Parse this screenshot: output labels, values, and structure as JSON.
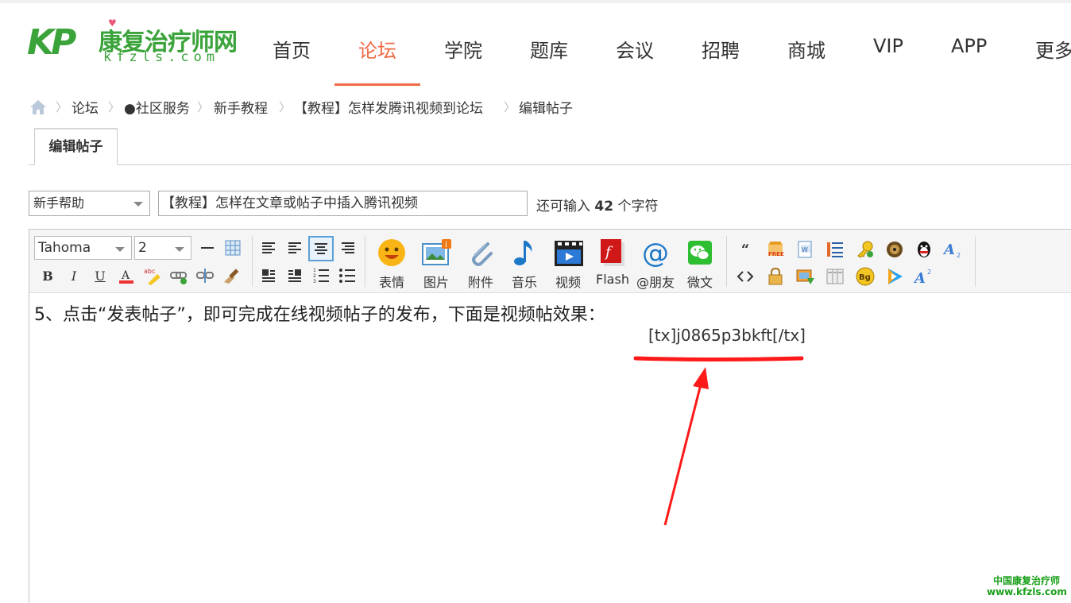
{
  "site": {
    "logo_mark": "KP",
    "logo_cn": "康复治疗师网",
    "logo_en": "kfzls.com"
  },
  "nav": {
    "items": [
      "首页",
      "论坛",
      "学院",
      "题库",
      "会议",
      "招聘",
      "商城",
      "VIP",
      "APP",
      "更多"
    ],
    "active_index": 1
  },
  "breadcrumb": {
    "items": [
      "论坛",
      "●社区服务",
      "新手教程",
      "【教程】怎样发腾讯视频到论坛",
      "编辑帖子"
    ],
    "separator": "〉"
  },
  "tabs": {
    "edit_post": "编辑帖子"
  },
  "form": {
    "category_selected": "新手帮助",
    "title_value": "【教程】怎样在文章或帖子中插入腾讯视频",
    "remaining_prefix": "还可输入",
    "remaining_count": "42",
    "remaining_suffix": "个字符"
  },
  "toolbar": {
    "font": "Tahoma",
    "size": "2",
    "buttons": {
      "emoji": "表情",
      "image": "图片",
      "attachment": "附件",
      "music": "音乐",
      "video": "视频",
      "flash": "Flash",
      "mention": "@朋友",
      "wechat": "微文"
    }
  },
  "editor": {
    "line1": "5、点击“发表帖子”，即可完成在线视频帖子的发布，下面是视频帖效果：",
    "code": "[tx]j0865p3bkft[/tx]"
  },
  "watermark": {
    "line1": "中国康复治疗师",
    "line2": "www.kfzls.com"
  },
  "colors": {
    "brand_green": "#3aa33a",
    "accent_orange": "#ef6a45",
    "annotation_red": "#ff1a1a"
  }
}
